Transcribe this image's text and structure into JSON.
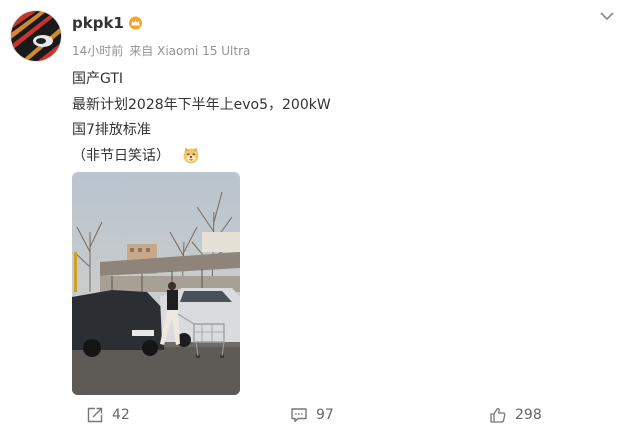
{
  "post": {
    "username": "pkpk1",
    "time": "14小时前",
    "source": "来自 Xiaomi 15 Ultra",
    "lines": [
      "国产GTI",
      "最新计划2028年下半年上evo5，200kW",
      "国7排放标准",
      "（非节日笑话）"
    ]
  },
  "footer": {
    "reposts": "42",
    "comments": "97",
    "likes": "298"
  },
  "icons": {
    "vip": "crown-badge-icon",
    "menu": "chevron-down-icon",
    "repost": "share-icon",
    "comment": "comment-icon",
    "like": "thumbs-up-icon",
    "emoji": "doge-emoji-icon"
  },
  "colors": {
    "meta_text": "#939393",
    "body_text": "#333333",
    "vip": "#f8a22d"
  }
}
